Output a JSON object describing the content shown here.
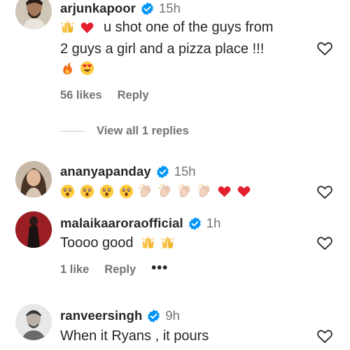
{
  "comments": [
    {
      "username": "arjunkapoor",
      "time": "15h",
      "text_line1": "u shot one of the guys from",
      "text_line2": "2 guys a girl and a pizza place !!!",
      "likes": "56 likes",
      "reply": "Reply",
      "view_replies": "View all 1 replies",
      "emojis_line1": [
        "raising-hands",
        "red-heart"
      ],
      "emojis_line3": [
        "fire",
        "heart-eyes"
      ]
    },
    {
      "username": "ananyapanday",
      "time": "15h",
      "emojis": [
        "astonished",
        "astonished",
        "astonished",
        "astonished",
        "clapping-hands",
        "clapping-hands",
        "clapping-hands",
        "clapping-hands",
        "red-heart",
        "red-heart"
      ]
    },
    {
      "username": "malaikaaroraofficial",
      "time": "1h",
      "text": "Toooo good",
      "emojis": [
        "raising-hands",
        "raising-hands"
      ],
      "likes": "1 like",
      "reply": "Reply",
      "more": "•••"
    },
    {
      "username": "ranveersingh",
      "time": "9h",
      "text": "When it Ryans , it pours"
    }
  ],
  "colors": {
    "verified_blue": "#0095f6",
    "secondary_text": "#737373",
    "primary_text": "#262626"
  }
}
